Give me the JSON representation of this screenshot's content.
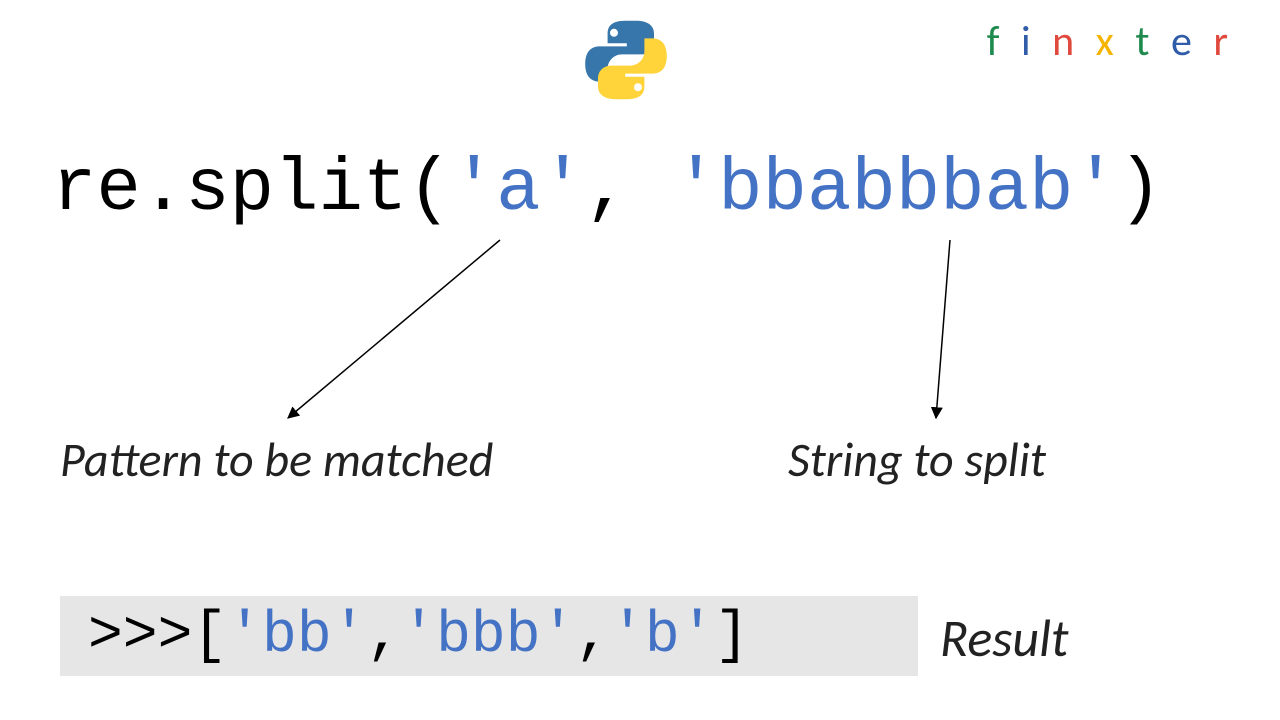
{
  "brand": {
    "letters": [
      {
        "ch": "f",
        "color": "#1F8A4D"
      },
      {
        "ch": "i",
        "color": "#2F5BA8"
      },
      {
        "ch": "n",
        "color": "#E0493E"
      },
      {
        "ch": "x",
        "color": "#F4B400"
      },
      {
        "ch": "t",
        "color": "#1F8A4D"
      },
      {
        "ch": "e",
        "color": "#2F5BA8"
      },
      {
        "ch": "r",
        "color": "#E0493E"
      }
    ]
  },
  "code": {
    "prefix": "re.split(",
    "arg1": "'a'",
    "sep": ", ",
    "arg2": "'bbabbbab'",
    "suffix": ")"
  },
  "labels": {
    "pattern": "Pattern to be matched",
    "string": "String to split",
    "result": "Result"
  },
  "result": {
    "prompt": ">>> ",
    "open": "[",
    "item1": "'bb'",
    "sep1": ", ",
    "item2": "'bbb'",
    "sep2": ", ",
    "item3": "'b'",
    "close": "]"
  }
}
